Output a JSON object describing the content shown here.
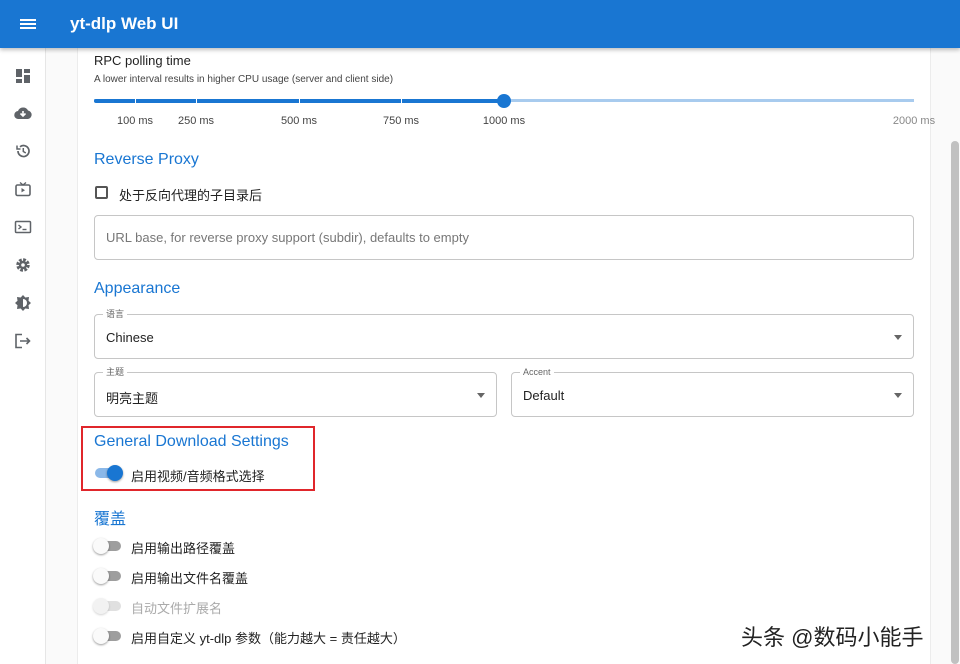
{
  "app": {
    "title": "yt-dlp Web UI"
  },
  "sidebar": {
    "items": [
      {
        "icon": "dashboard-icon"
      },
      {
        "icon": "cloud-download-icon"
      },
      {
        "icon": "history-icon"
      },
      {
        "icon": "live-tv-icon"
      },
      {
        "icon": "terminal-icon"
      },
      {
        "icon": "settings-gear-icon"
      },
      {
        "icon": "theme-brightness-icon"
      },
      {
        "icon": "logout-icon"
      }
    ]
  },
  "rpc": {
    "title": "RPC polling time",
    "helper": "A lower interval results in higher CPU usage (server and client side)",
    "value_ms": 1000,
    "min_ms": 100,
    "max_ms": 2000,
    "marks": [
      "100 ms",
      "250 ms",
      "500 ms",
      "750 ms",
      "1000 ms",
      "2000 ms"
    ]
  },
  "reverse_proxy": {
    "title": "Reverse Proxy",
    "checkbox_label": "处于反向代理的子目录后",
    "checkbox_checked": false,
    "url_placeholder": "URL base, for reverse proxy support (subdir), defaults to empty"
  },
  "appearance": {
    "title": "Appearance",
    "language_label": "语言",
    "language_value": "Chinese",
    "theme_label": "主题",
    "theme_value": "明亮主题",
    "accent_label": "Accent",
    "accent_value": "Default"
  },
  "general_download": {
    "title": "General Download Settings",
    "format_selection_label": "启用视频/音频格式选择",
    "format_selection_on": true
  },
  "overrides": {
    "title": "覆盖",
    "items": [
      {
        "label": "启用输出路径覆盖",
        "on": false,
        "disabled": false
      },
      {
        "label": "启用输出文件名覆盖",
        "on": false,
        "disabled": false
      },
      {
        "label": "自动文件扩展名",
        "on": false,
        "disabled": true
      },
      {
        "label": "启用自定义 yt-dlp 参数（能力越大 = 责任越大）",
        "on": false,
        "disabled": false
      }
    ]
  },
  "colors": {
    "primary": "#1976d2",
    "highlight": "#e0262b"
  },
  "watermark": "头条 @数码小能手"
}
